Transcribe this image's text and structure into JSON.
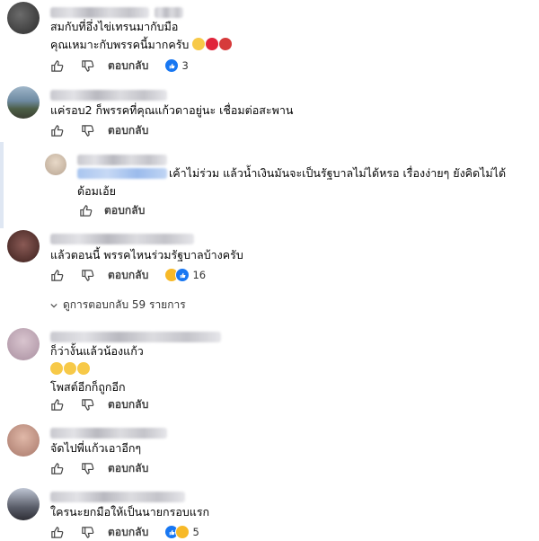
{
  "actions": {
    "reply_label": "ตอบกลับ"
  },
  "comments": [
    {
      "lines": [
        "สมกับที่อึ่งไข่เทรนมากับมือ",
        "คุณเหมาะกับพรรคนี้มากครับ"
      ],
      "reactions": "3"
    },
    {
      "lines": [
        "แค่รอบ2 ก็พรรคที่คุณแก้วดาอยู่นะ เชื่อมต่อสะพาน"
      ]
    },
    {
      "lines": [
        "เค้าไม่ร่วม แล้วน้ำเงินมันจะเป็นรัฐบาลไม่ได้หรอ เรื่องง่ายๆ ยังคิดไม่ได้",
        "ด้อมเอ้ย"
      ]
    },
    {
      "lines": [
        "แล้วตอนนี้ พรรคไหนร่วมรัฐบาลบ้างครับ"
      ],
      "reactions": "16"
    },
    {
      "lines": [
        "ก็ว่างั้นแล้วน้องแก้ว",
        "โพสต์อีกก็ถูกอีก"
      ]
    },
    {
      "lines": [
        "จัดไปพี่แก้วเอาอีกๆ"
      ]
    },
    {
      "lines": [
        "ใครนะยกมือให้เป็นนายกรอบแรก"
      ],
      "reactions": "5"
    }
  ],
  "more_replies": "ดูการตอบกลับ 59 รายการ",
  "colors": {
    "like_blue": "#1877f2",
    "text": "#050505",
    "muted": "#65676b"
  },
  "icons": {
    "like": "thumbs-up-icon",
    "dislike": "thumbs-down-icon"
  }
}
